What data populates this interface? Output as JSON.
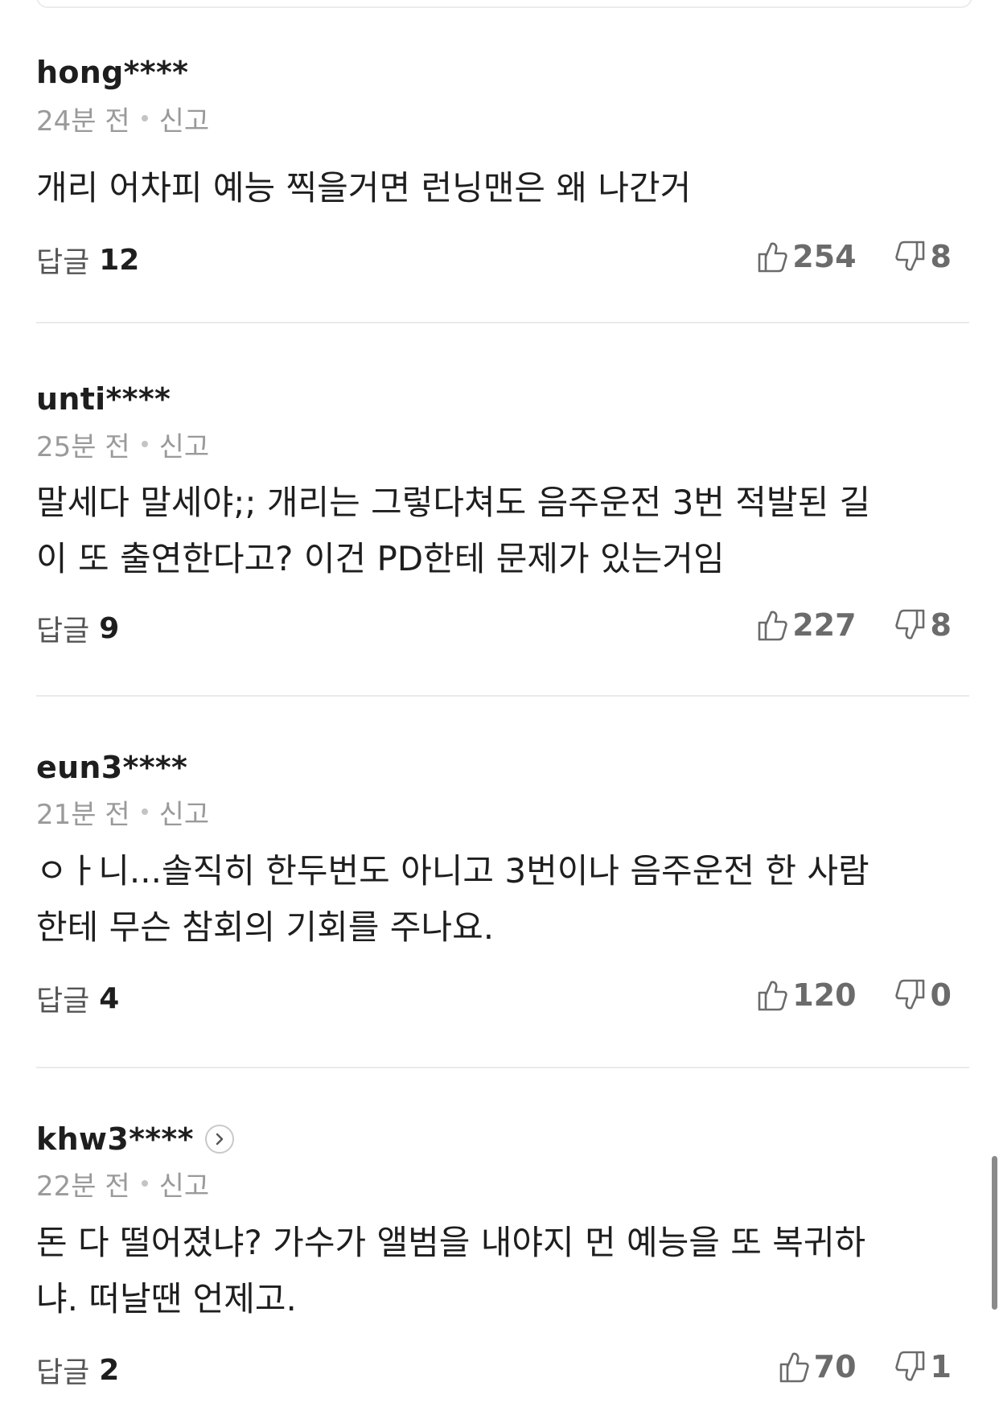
{
  "comments": [
    {
      "username": "hong****",
      "time": "24분 전",
      "report": "신고",
      "text": "개리 어차피 예능 찍을거면 런닝맨은 왜 나간거",
      "reply_label": "답글",
      "reply_count": "12",
      "likes": "254",
      "dislikes": "8"
    },
    {
      "username": "unti****",
      "time": "25분 전",
      "report": "신고",
      "text": "말세다 말세야;; 개리는 그렇다쳐도 음주운전 3번 적발된 길\n이 또 출연한다고? 이건 PD한테 문제가 있는거임",
      "reply_label": "답글",
      "reply_count": "9",
      "likes": "227",
      "dislikes": "8"
    },
    {
      "username": "eun3****",
      "time": "21분 전",
      "report": "신고",
      "text": "ㅇㅏ니...솔직히 한두번도 아니고 3번이나 음주운전 한 사람\n한테 무슨 참회의 기회를 주나요.",
      "reply_label": "답글",
      "reply_count": "4",
      "likes": "120",
      "dislikes": "0"
    },
    {
      "username": "khw3****",
      "time": "22분 전",
      "report": "신고",
      "text": "돈 다 떨어졌냐? 가수가 앨범을 내야지 먼 예능을 또 복귀하\n냐. 떠날땐 언제고.",
      "reply_label": "답글",
      "reply_count": "2",
      "likes": "70",
      "dislikes": "1"
    }
  ],
  "icons": {
    "like": "thumbs-up-icon",
    "dislike": "thumbs-down-icon",
    "profile_arrow": "chevron-right-icon"
  }
}
